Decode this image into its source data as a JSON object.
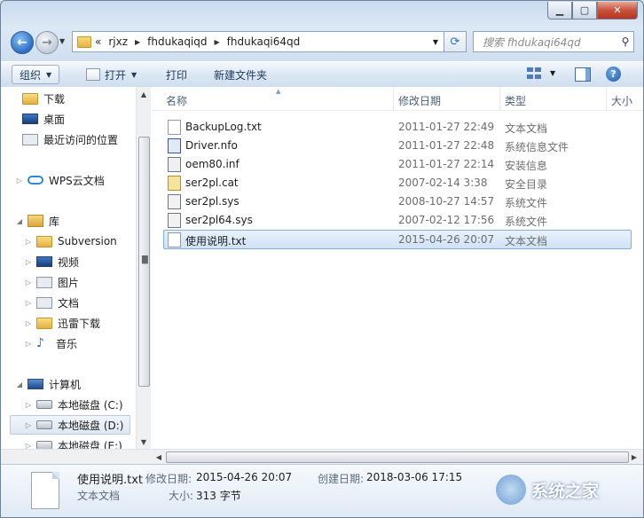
{
  "window": {
    "caption_buttons": [
      "minimize",
      "maximize",
      "close"
    ]
  },
  "address": {
    "overflow": "«",
    "crumbs": [
      "rjxz",
      "fhdukaqiqd",
      "fhdukaqi64qd"
    ],
    "search_placeholder": "搜索 fhdukaqi64qd"
  },
  "toolbar": {
    "organize": "组织",
    "open": "打开",
    "print": "打印",
    "new_folder": "新建文件夹"
  },
  "nav": {
    "favorites": [
      {
        "label": "下载",
        "icon": "downloads-folder-icon"
      },
      {
        "label": "桌面",
        "icon": "desktop-icon"
      },
      {
        "label": "最近访问的位置",
        "icon": "recent-places-icon"
      }
    ],
    "wps": "WPS云文档",
    "libraries": "库",
    "library_items": [
      "Subversion",
      "视频",
      "图片",
      "文档",
      "迅雷下载",
      "音乐"
    ],
    "computer": "计算机",
    "drives": [
      "本地磁盘 (C:)",
      "本地磁盘 (D:)",
      "本地磁盘 (E:)"
    ]
  },
  "columns": {
    "name": "名称",
    "date": "修改日期",
    "type": "类型",
    "size": "大小"
  },
  "files": [
    {
      "name": "BackupLog.txt",
      "date": "2011-01-27 22:49",
      "type": "文本文档",
      "icon": "text-file-icon"
    },
    {
      "name": "Driver.nfo",
      "date": "2011-01-27 22:48",
      "type": "系统信息文件",
      "icon": "system-info-file-icon"
    },
    {
      "name": "oem80.inf",
      "date": "2011-01-27 22:14",
      "type": "安装信息",
      "icon": "setup-info-file-icon"
    },
    {
      "name": "ser2pl.cat",
      "date": "2007-02-14 3:38",
      "type": "安全目录",
      "icon": "security-catalog-icon"
    },
    {
      "name": "ser2pl.sys",
      "date": "2008-10-27 14:57",
      "type": "系统文件",
      "icon": "system-file-icon"
    },
    {
      "name": "ser2pl64.sys",
      "date": "2007-02-12 17:56",
      "type": "系统文件",
      "icon": "system-file-icon"
    },
    {
      "name": "使用说明.txt",
      "date": "2015-04-26 20:07",
      "type": "文本文档",
      "icon": "text-file-icon",
      "selected": true
    }
  ],
  "details": {
    "filename": "使用说明.txt",
    "modified_label": "修改日期:",
    "modified_value": "2015-04-26 20:07",
    "created_label": "创建日期:",
    "created_value": "2018-03-06 17:15",
    "filetype": "文本文档",
    "size_label": "大小:",
    "size_value": "313 字节"
  },
  "watermark": {
    "text": "系统之家"
  }
}
